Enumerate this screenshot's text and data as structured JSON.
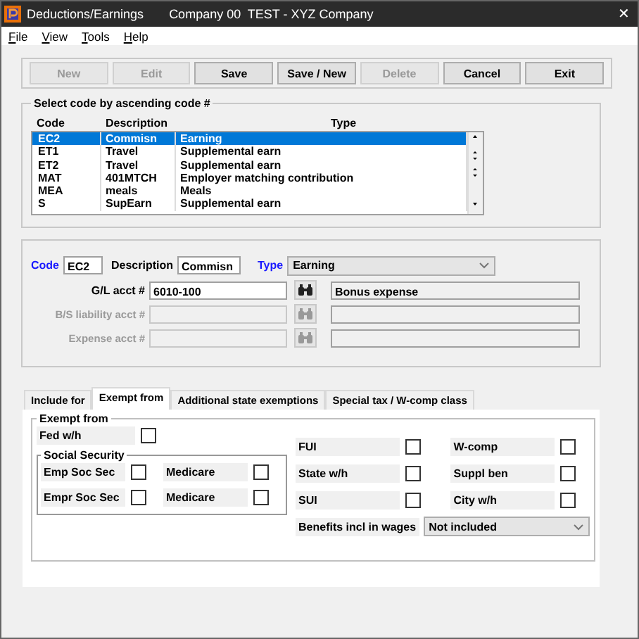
{
  "window": {
    "app": "Deductions/Earnings",
    "company": "Company 00  TEST - XYZ Company",
    "close": "✕"
  },
  "menu": [
    "File",
    "View",
    "Tools",
    "Help"
  ],
  "toolbar": [
    {
      "label": "New",
      "disabled": true
    },
    {
      "label": "Edit",
      "disabled": true
    },
    {
      "label": "Save",
      "disabled": false
    },
    {
      "label": "Save / New",
      "disabled": false
    },
    {
      "label": "Delete",
      "disabled": true
    },
    {
      "label": "Cancel",
      "disabled": false
    },
    {
      "label": "Exit",
      "disabled": false
    }
  ],
  "code_list": {
    "title": "Select code by ascending code #",
    "columns": [
      "Code",
      "Description",
      "Type"
    ],
    "rows": [
      {
        "code": "EC2",
        "description": "Commisn",
        "type": "Earning",
        "selected": true
      },
      {
        "code": "ET1",
        "description": "Travel",
        "type": "Supplemental earn",
        "selected": false
      },
      {
        "code": "ET2",
        "description": "Travel",
        "type": "Supplemental earn",
        "selected": false
      },
      {
        "code": "MAT",
        "description": "401MTCH",
        "type": "Employer matching contribution",
        "selected": false
      },
      {
        "code": "MEA",
        "description": "meals",
        "type": "Meals",
        "selected": false
      },
      {
        "code": "S",
        "description": "SupEarn",
        "type": "Supplemental earn",
        "selected": false
      }
    ]
  },
  "detail": {
    "code_label": "Code",
    "code": "EC2",
    "description_label": "Description",
    "description": "Commisn",
    "type_label": "Type",
    "type": "Earning",
    "accounts": [
      {
        "label": "G/L acct #",
        "value": "6010-100",
        "account_description": "Bonus expense",
        "disabled": false
      },
      {
        "label": "B/S liability acct #",
        "disabled": true
      },
      {
        "label": "Expense acct #",
        "disabled": true
      }
    ]
  },
  "tabs": [
    {
      "label": "Include for",
      "selected": false
    },
    {
      "label": "Exempt from",
      "selected": true
    },
    {
      "label": "Additional state exemptions",
      "selected": false
    },
    {
      "label": "Special tax / W-comp class",
      "selected": false
    }
  ],
  "exempt": {
    "title": "Exempt from",
    "fed": {
      "label": "Fed w/h",
      "checked": false
    },
    "social_security": {
      "title": "Social Security",
      "items": [
        {
          "label": "Emp Soc Sec",
          "checked": false
        },
        {
          "label": "Medicare",
          "checked": false
        },
        {
          "label": "Empr Soc Sec",
          "checked": false
        },
        {
          "label": "Medicare",
          "checked": false
        }
      ]
    },
    "other": [
      {
        "label": "FUI",
        "checked": false
      },
      {
        "label": "W-comp",
        "checked": false
      },
      {
        "label": "State w/h",
        "checked": false
      },
      {
        "label": "Suppl ben",
        "checked": false
      },
      {
        "label": "SUI",
        "checked": false
      },
      {
        "label": "City w/h",
        "checked": false
      }
    ],
    "benefits": {
      "label": "Benefits incl in wages",
      "value": "Not included"
    }
  }
}
